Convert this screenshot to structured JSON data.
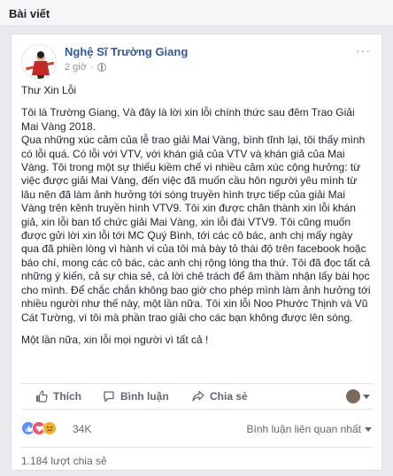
{
  "section": {
    "title": "Bài viết"
  },
  "post": {
    "author": "Nghệ Sĩ Trường Giang",
    "time": "2 giờ",
    "more": "···",
    "paragraphs": [
      "Thư Xin Lỗi",
      "Tôi là Trường Giang, Và đây là lời xin lỗi chính thức sau đêm Trao Giải Mai Vàng 2018.",
      "Qua những xúc cảm của lễ trao giải Mai Vàng, bình tĩnh lại, tôi thấy mình có lỗi quá. Có lỗi với VTV, với khán giả của VTV và khán giả của Mai Vàng. Tôi trong một sự thiếu kiềm chế vì nhiều cảm xúc cộng hưởng: từ việc được giải Mai Vàng, đến việc đã muốn cầu hôn người yêu mình từ lâu nên đã làm ảnh hưởng tới sóng truyền hình trực tiếp của giải Mai Vàng trên kênh truyền hình VTV9. Tôi xin được chân thành xin lỗi khán giả, xin lỗi ban tổ chức giải Mai Vàng, xin lỗi đài VTV9. Tôi cũng muốn được gửi lời xin lỗi tới MC Quý Bình, tới các cô bác, anh chị mấy ngày qua đã phiền lòng vì hành vi của tôi mà bày tỏ thái độ trên facebook hoặc báo chí, mong các cô bác, các anh chị rộng lòng tha thứ. Tôi đã đọc tất cả những ý kiến, cả sự chia sẻ, cả lời chê trách để âm thầm nhận lấy bài học cho mình. Để chắc chắn không bao giờ cho phép mình làm ảnh hưởng tới nhiều người như thế này, một lần nữa. Tôi xin lỗi Noo Phước Thịnh và Vũ Cát Tường, vì tôi mà phần trao giải cho các bạn không được lên sóng.",
      "Một lần nữa, xin lỗi mọi người vì tất cả !"
    ]
  },
  "actions": {
    "like": "Thích",
    "comment": "Bình luận",
    "share": "Chia sẻ"
  },
  "reactions": {
    "count": "34K",
    "sort_label": "Bình luận liên quan nhất"
  },
  "shares_label": "1.184 lượt chia sẻ",
  "colors": {
    "link": "#365899",
    "like": "#5890ff",
    "love": "#f25268",
    "sad": "#f7b125"
  }
}
